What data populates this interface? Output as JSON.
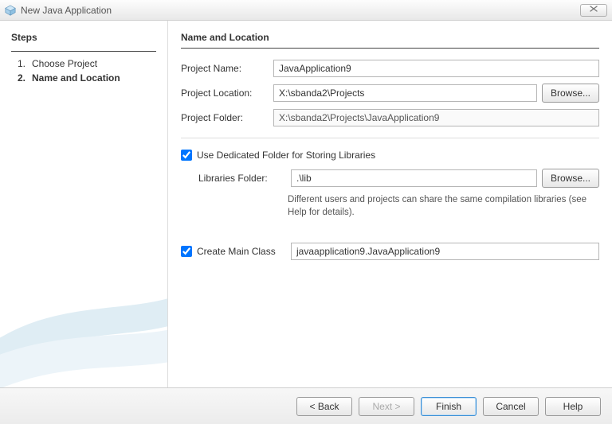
{
  "window": {
    "title": "New Java Application"
  },
  "sidebar": {
    "heading": "Steps",
    "steps": [
      {
        "num": "1.",
        "label": "Choose Project",
        "current": false
      },
      {
        "num": "2.",
        "label": "Name and Location",
        "current": true
      }
    ]
  },
  "main": {
    "heading": "Name and Location",
    "projectName": {
      "label": "Project Name:",
      "value": "JavaApplication9"
    },
    "projectLocation": {
      "label": "Project Location:",
      "value": "X:\\sbanda2\\Projects",
      "browse": "Browse..."
    },
    "projectFolder": {
      "label": "Project Folder:",
      "value": "X:\\sbanda2\\Projects\\JavaApplication9"
    },
    "dedicatedFolder": {
      "checkboxLabel": "Use Dedicated Folder for Storing Libraries",
      "checked": true,
      "librariesLabel": "Libraries Folder:",
      "librariesValue": ".\\lib",
      "browse": "Browse...",
      "hint": "Different users and projects can share the same compilation libraries (see Help for details)."
    },
    "createMain": {
      "checkboxLabel": "Create Main Class",
      "checked": true,
      "value": "javaapplication9.JavaApplication9"
    }
  },
  "footer": {
    "back": "< Back",
    "next": "Next >",
    "finish": "Finish",
    "cancel": "Cancel",
    "help": "Help"
  }
}
